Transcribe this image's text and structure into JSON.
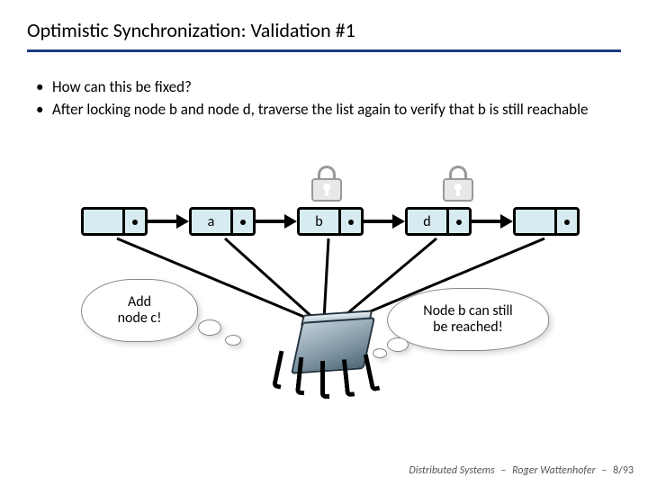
{
  "title": "Optimistic Synchronization: Validation #1",
  "bullets": [
    "How can this be fixed?",
    "After locking node b and node d, traverse the list again to verify that b is still reachable"
  ],
  "nodes": {
    "n0": "",
    "n1": "a",
    "n2": "b",
    "n3": "d",
    "n4": ""
  },
  "clouds": {
    "left": "Add\nnode c!",
    "right": "Node b can still\nbe reached!"
  },
  "footer": {
    "course": "Distributed Systems",
    "author": "Roger Wattenhofer",
    "page": "8/93"
  }
}
